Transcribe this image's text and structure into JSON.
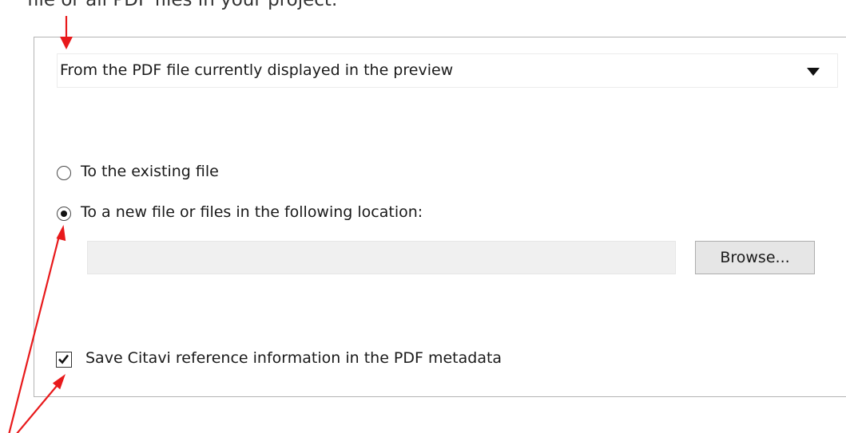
{
  "intro": {
    "trailing_text": "file or all PDF files in your project."
  },
  "source": {
    "selected": "From the PDF file currently displayed in the preview"
  },
  "save_target": {
    "options": [
      {
        "label": "To the existing file",
        "selected": false
      },
      {
        "label": "To a new file or files in the following location:",
        "selected": true
      }
    ],
    "location_value": "",
    "browse_label": "Browse..."
  },
  "metadata": {
    "label": "Save Citavi reference information in the PDF metadata",
    "checked": true
  },
  "colors": {
    "annotation_arrow": "#e8191b"
  },
  "icons": {
    "dropdown": "chevron-down-icon",
    "checkbox": "checkmark-icon",
    "annotation": "arrow-icon"
  }
}
